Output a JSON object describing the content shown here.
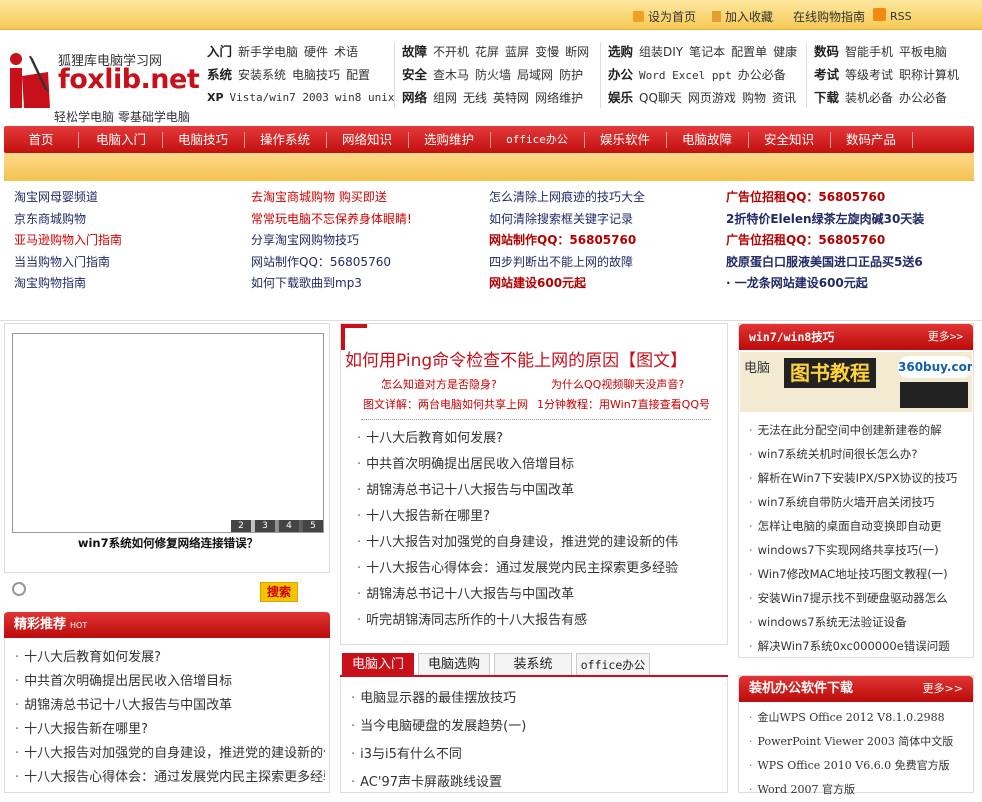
{
  "topbar": {
    "set_home": "设为首页",
    "bookmark": "加入收藏",
    "guide": "在线购物指南",
    "rss": "RSS",
    "colors": {
      "home": "#f0a020",
      "bookmark": "#e0a030",
      "rss": "#f38a10"
    }
  },
  "logo": {
    "site_name": "狐狸库电脑学习网",
    "brand": "foxlib.net",
    "slogan": "轻松学电脑  零基础学电脑",
    "brand_color": "#c8101a"
  },
  "categories": [
    {
      "rows": [
        {
          "label": "入门",
          "links": [
            "新手学电脑",
            "硬件",
            "术语"
          ]
        },
        {
          "label": "系统",
          "links": [
            "安装系统",
            "电脑技巧",
            "配置"
          ]
        },
        {
          "label": "XP",
          "links": [
            "Vista/win7 2003",
            "win8 unix"
          ]
        }
      ]
    },
    {
      "rows": [
        {
          "label": "故障",
          "links": [
            "不开机",
            "花屏",
            "蓝屏",
            "变慢",
            "断网"
          ]
        },
        {
          "label": "安全",
          "links": [
            "查木马",
            "防火墙",
            "局域网",
            "防护"
          ]
        },
        {
          "label": "网络",
          "links": [
            "组网",
            "无线",
            "英特网",
            "网络维护"
          ]
        }
      ]
    },
    {
      "rows": [
        {
          "label": "选购",
          "links": [
            "组装DIY",
            "笔记本",
            "配置单",
            "健康"
          ]
        },
        {
          "label": "办公",
          "links": [
            "Word Excel ppt",
            "办公必备"
          ]
        },
        {
          "label": "娱乐",
          "links": [
            "QQ聊天",
            "网页游戏",
            "购物",
            "资讯"
          ]
        }
      ]
    },
    {
      "rows": [
        {
          "label": "数码",
          "links": [
            "智能手机",
            "平板电脑"
          ]
        },
        {
          "label": "考试",
          "links": [
            "等级考试",
            "职称计算机"
          ]
        },
        {
          "label": "下载",
          "links": [
            "装机必备",
            "办公必备"
          ]
        }
      ]
    }
  ],
  "nav": [
    "首页",
    "电脑入门",
    "电脑技巧",
    "操作系统",
    "网络知识",
    "选购维护",
    "office办公",
    "娱乐软件",
    "电脑故障",
    "安全知识",
    "数码产品"
  ],
  "promo": [
    [
      {
        "text": "淘宝网母婴频道",
        "style": "navy"
      },
      {
        "text": "京东商城购物",
        "style": "navy"
      },
      {
        "text": "亚马逊购物入门指南",
        "style": "red"
      },
      {
        "text": "当当购物入门指南",
        "style": "navy"
      },
      {
        "text": "淘宝购物指南",
        "style": "navy"
      }
    ],
    [
      {
        "text": "去淘宝商城购物 购买即送",
        "style": "red"
      },
      {
        "text": "常常玩电脑不忘保养身体眼睛!",
        "style": "red"
      },
      {
        "text": "分享淘宝网购物技巧",
        "style": "navy"
      },
      {
        "text": "网站制作QQ：56805760",
        "style": "navy"
      },
      {
        "text": "如何下载歌曲到mp3",
        "style": "navy"
      }
    ],
    [
      {
        "text": "怎么清除上网痕迹的技巧大全",
        "style": "navy"
      },
      {
        "text": "如何清除搜索框关键字记录",
        "style": "navy"
      },
      {
        "text": "网站制作QQ：56805760",
        "style": "darkred"
      },
      {
        "text": "四步判断出不能上网的故障",
        "style": "navy"
      },
      {
        "text": "网站建设600元起",
        "style": "darkred"
      }
    ],
    [
      {
        "text": "广告位招租QQ：56805760",
        "style": "darkred"
      },
      {
        "text": "2折特价Elelen绿茶左旋肉碱30天装",
        "style": "navybold"
      },
      {
        "text": "广告位招租QQ：56805760",
        "style": "darkred"
      },
      {
        "text": "胶原蛋白口服液美国进口正品买5送6",
        "style": "navybold"
      },
      {
        "text": "· 一龙条网站建设600元起",
        "style": "navybold"
      }
    ]
  ],
  "slideshow": {
    "caption": "win7系统如何修复网络连接错误？",
    "numbers": [
      "2",
      "3",
      "4",
      "5"
    ]
  },
  "search": {
    "placeholder": "",
    "button": "搜索"
  },
  "featured": {
    "title": "精彩推荐",
    "tag": "HOT",
    "items": [
      "十八大后教育如何发展?",
      "中共首次明确提出居民收入倍增目标",
      "胡锦涛总书记十八大报告与中国改革",
      "十八大报告新在哪里?",
      "十八大报告对加强党的自身建设，推进党的建设新的伟",
      "十八大报告心得体会：通过发展党内民主探索更多经验"
    ]
  },
  "headline": {
    "title": "如何用Ping命令检查不能上网的原因【图文】",
    "subs": [
      "怎么知道对方是否隐身?",
      "为什么QQ视频聊天没声音?",
      "图文详解：两台电脑如何共享上网",
      "1分钟教程：用Win7直接查看QQ号"
    ],
    "items": [
      "十八大后教育如何发展?",
      "中共首次明确提出居民收入倍增目标",
      "胡锦涛总书记十八大报告与中国改革",
      "十八大报告新在哪里?",
      "十八大报告对加强党的自身建设，推进党的建设新的伟",
      "十八大报告心得体会：通过发展党内民主探索更多经验",
      "胡锦涛总书记十八大报告与中国改革",
      "听完胡锦涛同志所作的十八大报告有感"
    ]
  },
  "tabs": {
    "labels": [
      "电脑入门",
      "电脑选购",
      "装系统",
      "office办公"
    ],
    "items": [
      "电脑显示器的最佳摆放技巧",
      "当今电脑硬盘的发展趋势(一)",
      "i3与i5有什么不同",
      "AC'97声卡屏蔽跳线设置"
    ]
  },
  "win": {
    "title": "win7/win8技巧",
    "more": "更多>>",
    "banner_small": "电脑",
    "banner_big": "图书教程",
    "banner_logo": "360buy.com",
    "items": [
      "无法在此分配空间中创建新建卷的解",
      "win7系统关机时间很长怎么办?",
      "解析在Win7下安装IPX/SPX协议的技巧",
      "win7系统自带防火墙开启关闭技巧",
      "怎样让电脑的桌面自动变换即自动更",
      "windows7下实现网络共享技巧(一)",
      "Win7修改MAC地址技巧图文教程(一)",
      "安装Win7提示找不到硬盘驱动器怎么",
      "windows7系统无法验证设备",
      "解决Win7系统0xc000000e错误问题"
    ]
  },
  "soft": {
    "title": "装机办公软件下载",
    "more": "更多>>",
    "items": [
      "金山WPS Office 2012 V8.1.0.2988",
      "PowerPoint Viewer 2003 简体中文版",
      "WPS Office 2010 V6.6.0 免费官方版",
      "Word 2007 官方版"
    ]
  }
}
